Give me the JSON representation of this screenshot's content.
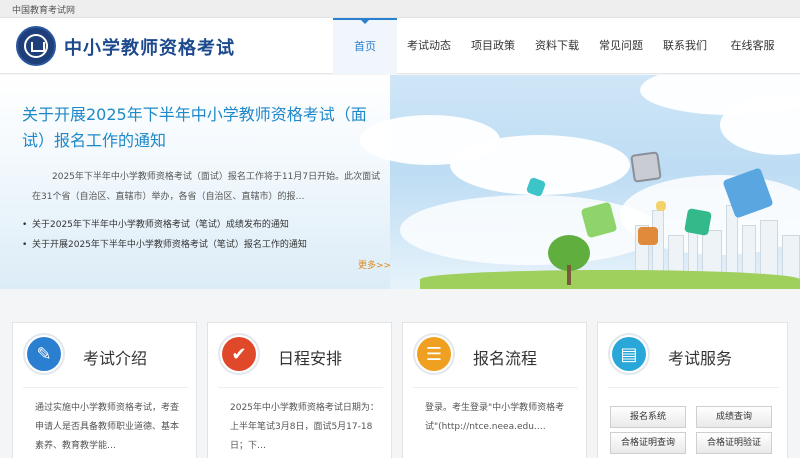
{
  "topbar": {
    "text": "中国教育考试网"
  },
  "header": {
    "site_title": "中小学教师资格考试"
  },
  "nav": {
    "items": [
      {
        "label": "首页",
        "active": true
      },
      {
        "label": "考试动态"
      },
      {
        "label": "项目政策"
      },
      {
        "label": "资料下载"
      },
      {
        "label": "常见问题"
      },
      {
        "label": "联系我们"
      },
      {
        "label": "在线客服"
      }
    ]
  },
  "banner": {
    "title": "关于开展2025年下半年中小学教师资格考试（面试）报名工作的通知",
    "desc": "2025年下半年中小学教师资格考试（面试）报名工作将于11月7日开始。此次面试在31个省（自治区、直辖市）举办，各省（自治区、直辖市）的报…",
    "news": [
      "关于2025年下半年中小学教师资格考试（笔试）成绩发布的通知",
      "关于开展2025年下半年中小学教师资格考试（笔试）报名工作的通知"
    ],
    "more": "更多>>"
  },
  "cards": [
    {
      "title": "考试介绍",
      "icon": "document-pen-icon",
      "color": "#2b7fd0",
      "text": "通过实施中小学教师资格考试，考查申请人是否具备教师职业道德、基本素养、教育教学能…"
    },
    {
      "title": "日程安排",
      "icon": "checkmark-icon",
      "color": "#e0482a",
      "text": "2025年中小学教师资格考试日期为：上半年笔试3月8日，面试5月17-18日；下…"
    },
    {
      "title": "报名流程",
      "icon": "form-pen-icon",
      "color": "#f0a020",
      "text": "登录。考生登录\"中小学教师资格考试\"(http://ntce.neea.edu.…"
    },
    {
      "title": "考试服务",
      "icon": "address-book-icon",
      "color": "#2aa7d9",
      "buttons": [
        "报名系统",
        "成绩查询",
        "合格证明查询",
        "合格证明验证"
      ]
    }
  ]
}
